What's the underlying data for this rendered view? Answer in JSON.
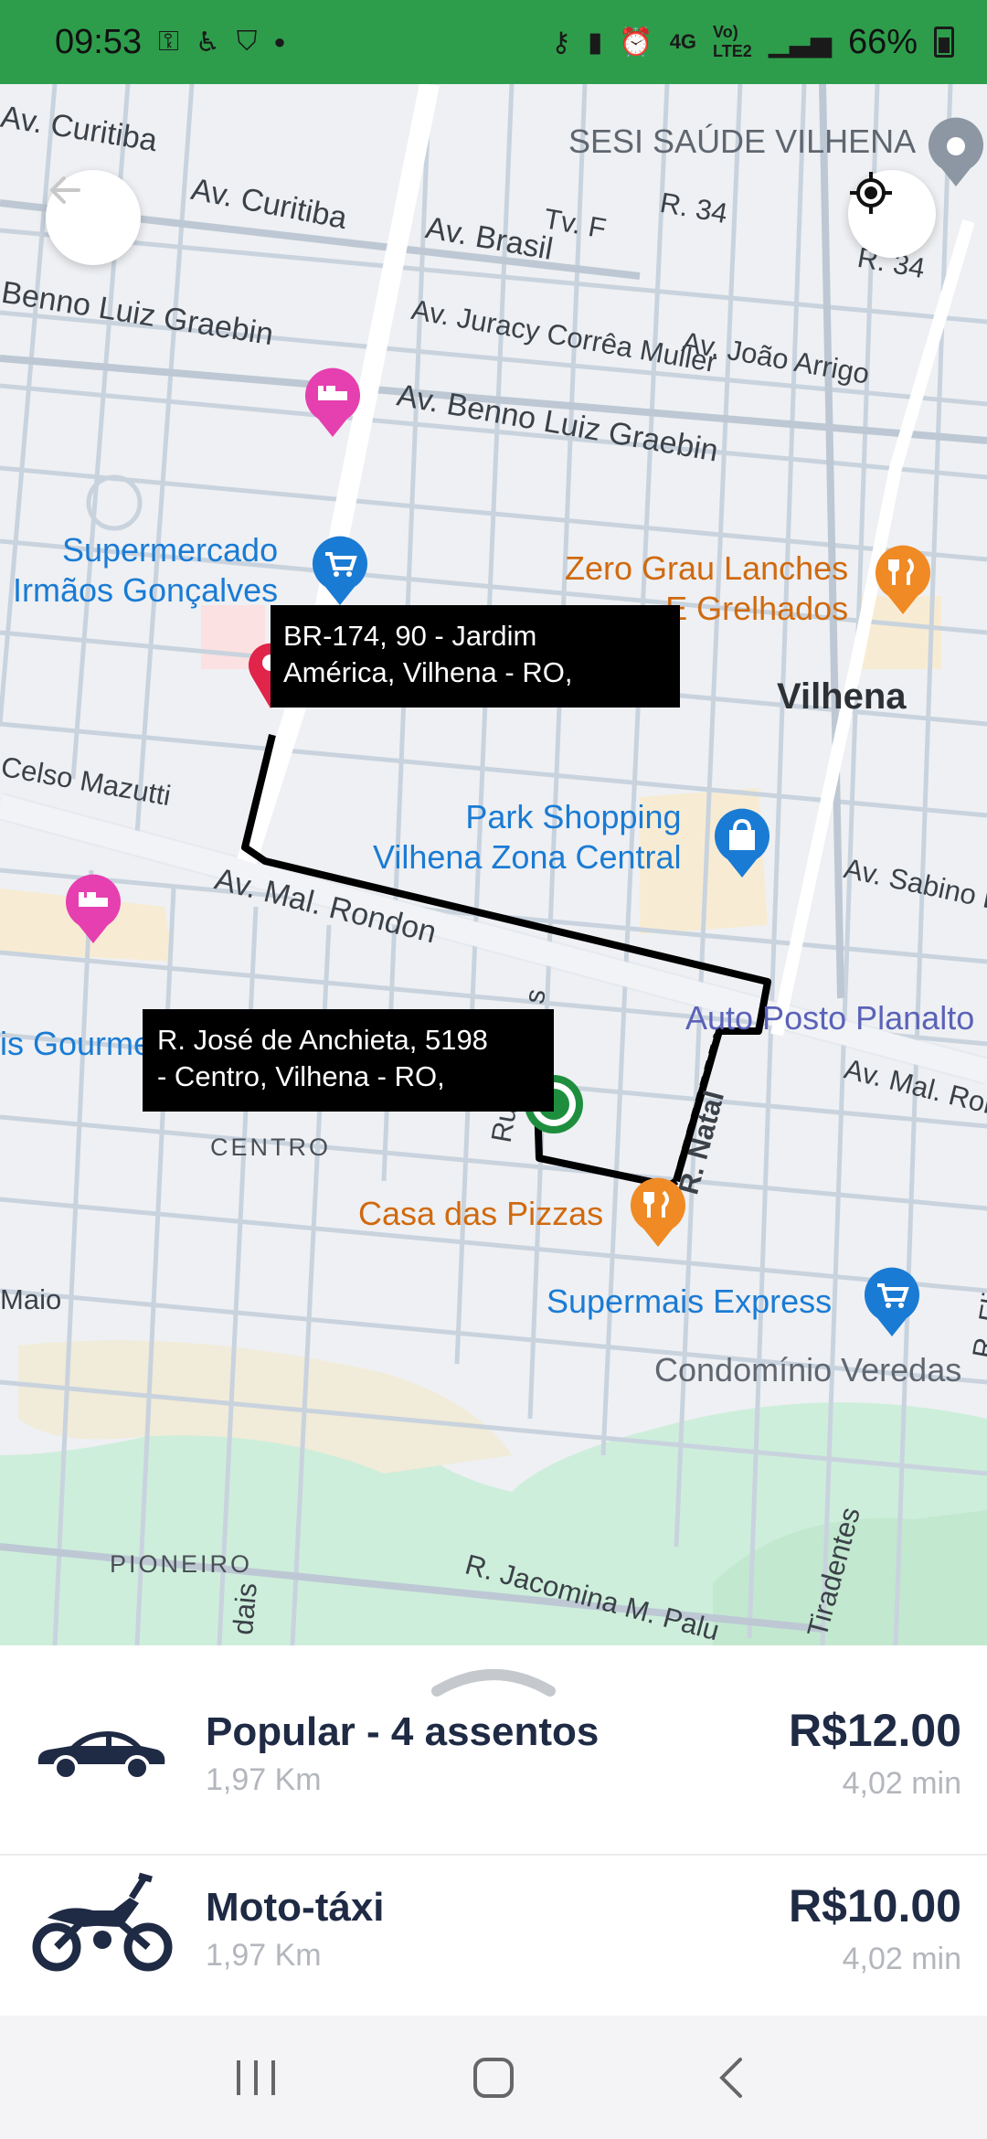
{
  "status_bar": {
    "time": "09:53",
    "battery": "66%",
    "network": "4G",
    "icons_left": [
      "key-lock-icon",
      "accessibility-icon",
      "shield-icon",
      "dot-icon"
    ],
    "icons_right": [
      "vpn-key-icon",
      "battery-saver-icon",
      "alarm-icon",
      "signal-4g-icon",
      "volte-signal-icon",
      "signal-icon",
      "battery-icon"
    ]
  },
  "map": {
    "labels": {
      "sesi": "SESI SAÚDE VILHENA",
      "curitiba1": "Av. Curitiba",
      "curitiba2": "Av. Curitiba",
      "brasil": "Av. Brasil",
      "tvf": "Tv. F",
      "r34a": "R. 34",
      "r34b": "R. 34",
      "benno1": "Benno Luiz Graebin",
      "juracy": "Av. Juracy Corrêa Muller",
      "joao": "Av. João Arrigo",
      "benno2": "Av. Benno Luiz Graebin",
      "supermercado": "Supermercado\nIrmãos Gonçalves",
      "zero_grau": "Zero Grau Lanches\nE Grelhados",
      "vilhena": "Vilhena",
      "celso": "Celso Mazutti",
      "park": "Park Shopping\nVilhena Zona Central",
      "sabino": "Av. Sabino B",
      "rondon1": "Av. Mal. Rondon",
      "posto": "Auto Posto Planalto",
      "gourmet": "is Gourme",
      "rondon2": "Av. Mal. Ron",
      "centro": "CENTRO",
      "natal": "R. Natal",
      "rua": "Ru",
      "s": "s",
      "pizzas": "Casa das Pizzas",
      "supermais": "Supermais Express",
      "maio": "Maio",
      "condominio": "Condomínio Veredas",
      "rfi": "R. Fli",
      "pioneiro": "PIONEIRO",
      "jacomina": "R. Jacomina M. Palu",
      "tiradentes": "Tiradentes",
      "dais": "dais"
    },
    "destination_address": "BR-174, 90 - Jardim\nAmérica, Vilhena - RO,",
    "origin_address": "R. José de Anchieta, 5198\n- Centro, Vilhena - RO,",
    "colors": {
      "route": "#000000",
      "destination_pin": "#e0244a",
      "origin_marker": "#1e8e3e",
      "poi_blue": "#1a7bd4",
      "poi_orange": "#f08a24",
      "poi_pink": "#e63fb0"
    }
  },
  "sheet": {
    "options": [
      {
        "title": "Popular - 4 assentos",
        "distance": "1,97 Km",
        "price": "R$12.00",
        "time": "4,02 min",
        "icon": "car-icon"
      },
      {
        "title": "Moto-táxi",
        "distance": "1,97 Km",
        "price": "R$10.00",
        "time": "4,02 min",
        "icon": "motorcycle-icon"
      }
    ]
  },
  "nav": {
    "buttons": [
      "recents-icon",
      "home-icon",
      "back-icon"
    ]
  }
}
